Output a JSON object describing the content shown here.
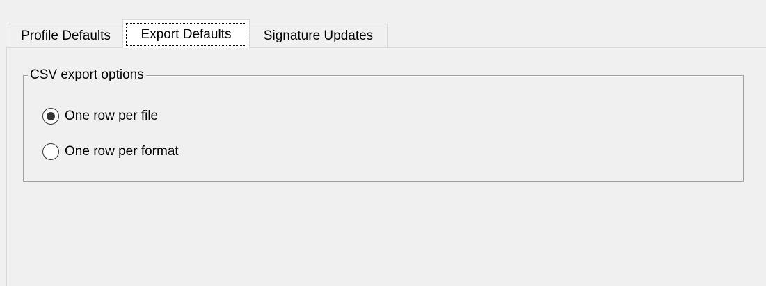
{
  "tabs": [
    {
      "label": "Profile Defaults",
      "selected": false
    },
    {
      "label": "Export Defaults",
      "selected": true
    },
    {
      "label": "Signature Updates",
      "selected": false
    }
  ],
  "csv_export": {
    "group_label": "CSV export options",
    "options": [
      {
        "label": "One row per file",
        "checked": true
      },
      {
        "label": "One row per format",
        "checked": false
      }
    ]
  }
}
